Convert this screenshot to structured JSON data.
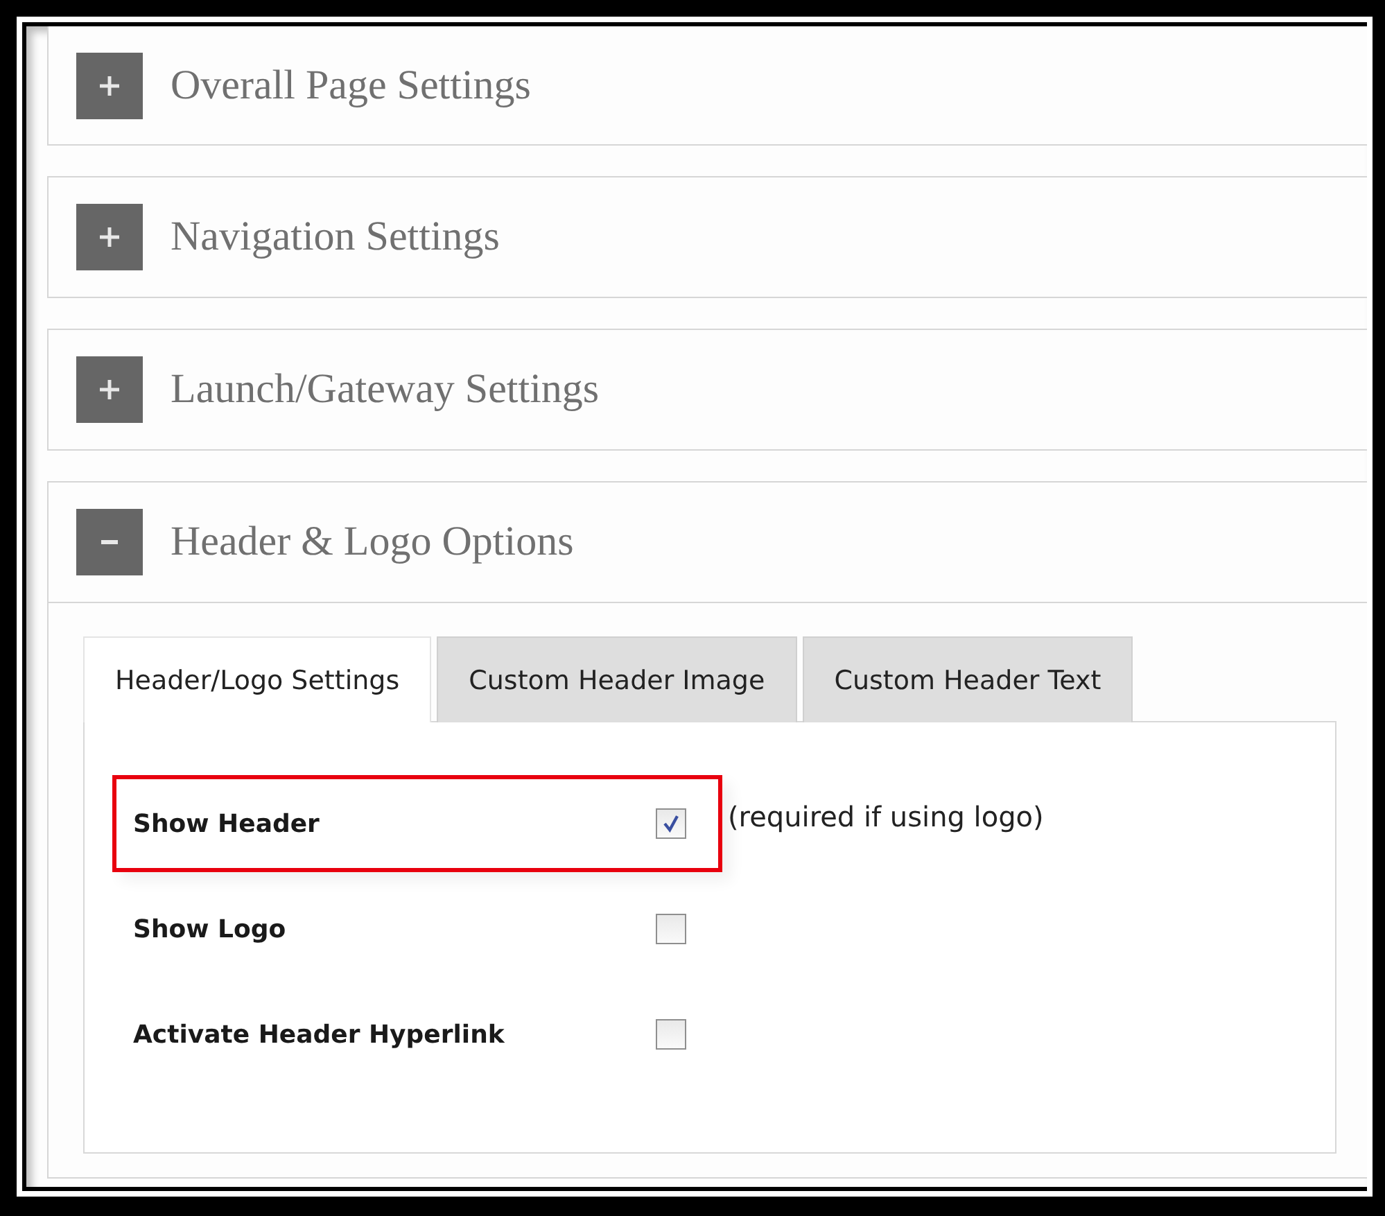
{
  "panels": [
    {
      "title": "Overall Page Settings",
      "expanded": false
    },
    {
      "title": "Navigation Settings",
      "expanded": false
    },
    {
      "title": "Launch/Gateway Settings",
      "expanded": false
    },
    {
      "title": "Header & Logo Options",
      "expanded": true,
      "tabs": [
        {
          "label": "Header/Logo Settings",
          "selected": true
        },
        {
          "label": "Custom Header Image",
          "selected": false
        },
        {
          "label": "Custom Header Text",
          "selected": false
        }
      ],
      "options": [
        {
          "label": "Show Header",
          "checked": true,
          "highlighted": true,
          "note": "(required if using logo)"
        },
        {
          "label": "Show Logo",
          "checked": false,
          "highlighted": false
        },
        {
          "label": "Activate Header Hyperlink",
          "checked": false,
          "highlighted": false
        }
      ]
    }
  ]
}
